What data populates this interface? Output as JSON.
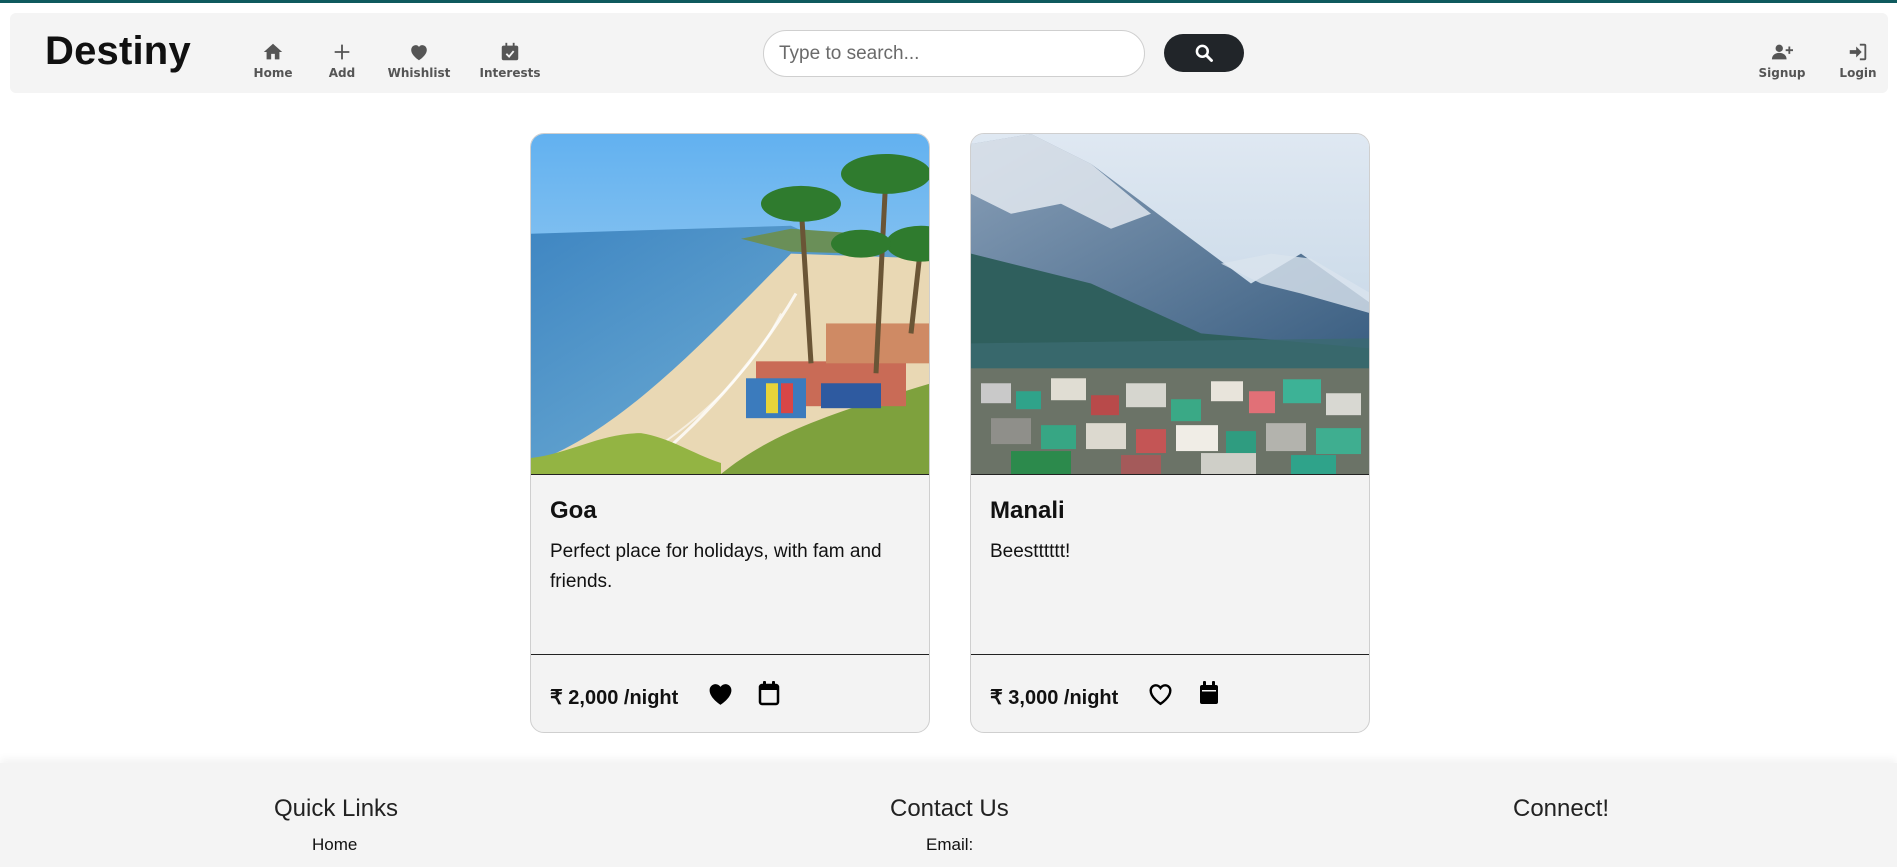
{
  "brand": "Destiny",
  "nav": {
    "home": "Home",
    "add": "Add",
    "wishlist": "Whishlist",
    "interests": "Interests",
    "signup": "Signup",
    "login": "Login"
  },
  "search": {
    "placeholder": "Type to search...",
    "icon": "search-icon"
  },
  "listings": [
    {
      "title": "Goa",
      "description": "Perfect place for holidays, with fam and friends.",
      "price": "₹ 2,000 /night",
      "wishlisted": true,
      "booked": false
    },
    {
      "title": "Manali",
      "description": "Beestttttt!",
      "price": "₹ 3,000 /night",
      "wishlisted": false,
      "booked": true
    }
  ],
  "footer": {
    "quick_links_title": "Quick Links",
    "quick_links": [
      "Home"
    ],
    "contact_title": "Contact Us",
    "contact_email_label": "Email:",
    "connect_title": "Connect!"
  },
  "colors": {
    "accent_line": "#0f5a5e",
    "search_button": "#212529",
    "nav_bg": "#f4f4f4"
  }
}
